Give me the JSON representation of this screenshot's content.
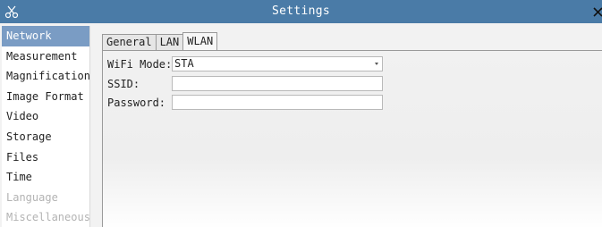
{
  "window": {
    "title": "Settings",
    "titlebar_color": "#4a7ba7"
  },
  "sidebar": {
    "items": [
      {
        "label": "Network",
        "state": "selected"
      },
      {
        "label": "Measurement",
        "state": "normal"
      },
      {
        "label": "Magnification",
        "state": "normal"
      },
      {
        "label": "Image Format",
        "state": "normal"
      },
      {
        "label": "Video",
        "state": "normal"
      },
      {
        "label": "Storage",
        "state": "normal"
      },
      {
        "label": "Files",
        "state": "normal"
      },
      {
        "label": "Time",
        "state": "normal"
      },
      {
        "label": "Language",
        "state": "disabled"
      },
      {
        "label": "Miscellaneous",
        "state": "disabled"
      }
    ]
  },
  "tabs": [
    {
      "label": "General",
      "active": false
    },
    {
      "label": "LAN",
      "active": false
    },
    {
      "label": "WLAN",
      "active": true
    }
  ],
  "form": {
    "wifi_mode_label": "WiFi Mode:",
    "wifi_mode_value": "STA",
    "ssid_label": "SSID:",
    "ssid_value": "",
    "password_label": "Password:",
    "password_value": ""
  },
  "icons": {
    "app": "scissors-icon",
    "close": "close-icon",
    "dropdown": "dropdown-arrow-icon"
  }
}
